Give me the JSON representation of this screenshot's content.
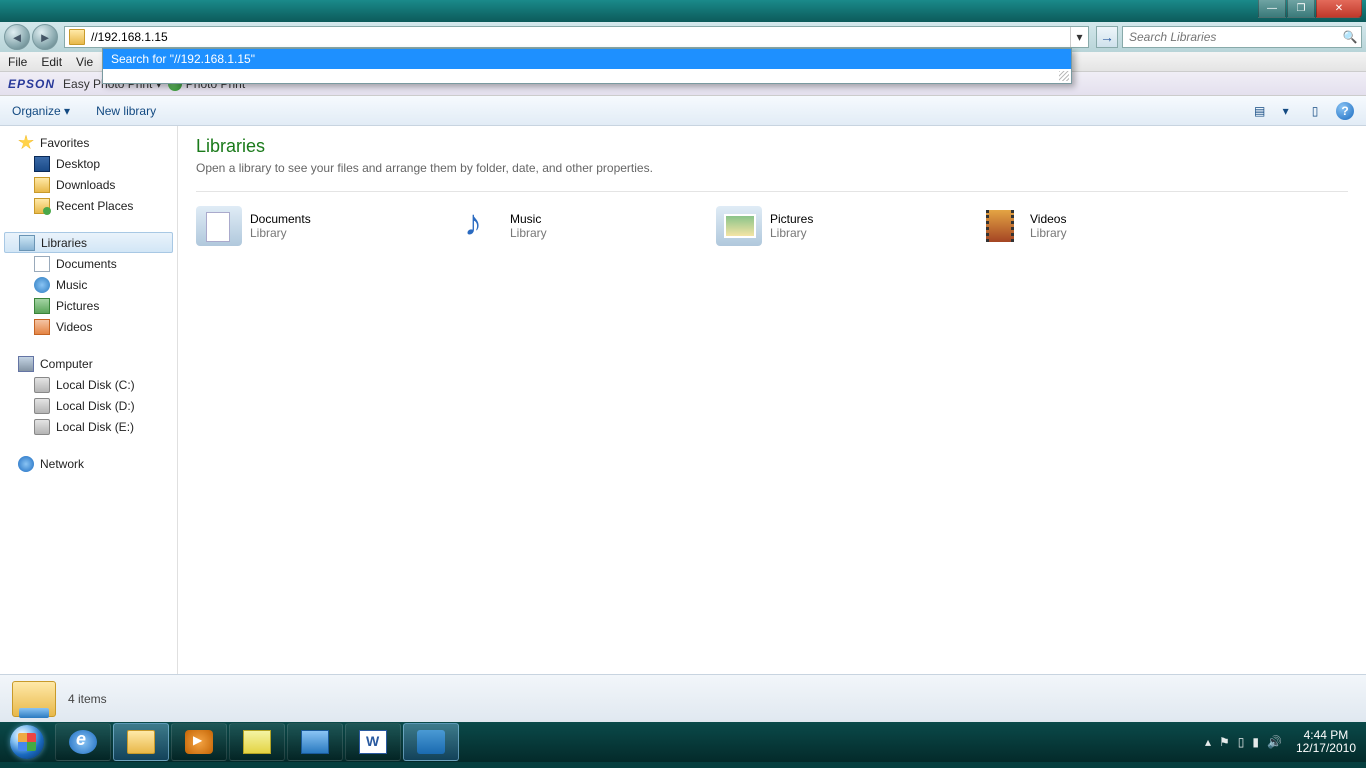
{
  "titlebar": {
    "min": "—",
    "max": "❐",
    "close": "✕"
  },
  "address": {
    "value": "//192.168.1.15",
    "go": "→",
    "dropdown": "▾",
    "suggestion": "Search for \"//192.168.1.15\""
  },
  "search": {
    "placeholder": "Search Libraries",
    "icon": "🔍"
  },
  "menu": {
    "file": "File",
    "edit": "Edit",
    "view": "Vie"
  },
  "epson": {
    "logo": "EPSON",
    "easy": "Easy Photo Print",
    "arrow": "▾",
    "photo": "Photo Print"
  },
  "toolbar": {
    "organize": "Organize",
    "organize_arrow": "▾",
    "newlib": "New library",
    "view": "▤",
    "view_arrow": "▾",
    "preview": "▯",
    "help": "?"
  },
  "sidebar": {
    "favorites": {
      "label": "Favorites",
      "items": [
        "Desktop",
        "Downloads",
        "Recent Places"
      ]
    },
    "libraries": {
      "label": "Libraries",
      "items": [
        "Documents",
        "Music",
        "Pictures",
        "Videos"
      ]
    },
    "computer": {
      "label": "Computer",
      "items": [
        "Local Disk (C:)",
        "Local Disk (D:)",
        "Local Disk (E:)"
      ]
    },
    "network": {
      "label": "Network"
    }
  },
  "content": {
    "title": "Libraries",
    "subtitle": "Open a library to see your files and arrange them by folder, date, and other properties.",
    "items": [
      {
        "name": "Documents",
        "type": "Library"
      },
      {
        "name": "Music",
        "type": "Library"
      },
      {
        "name": "Pictures",
        "type": "Library"
      },
      {
        "name": "Videos",
        "type": "Library"
      }
    ]
  },
  "status": {
    "text": "4 items"
  },
  "tray": {
    "up": "▴",
    "flag": "⚑",
    "battery": "▯",
    "wifi": "▮",
    "vol": "🔊",
    "time": "4:44 PM",
    "date": "12/17/2010"
  }
}
